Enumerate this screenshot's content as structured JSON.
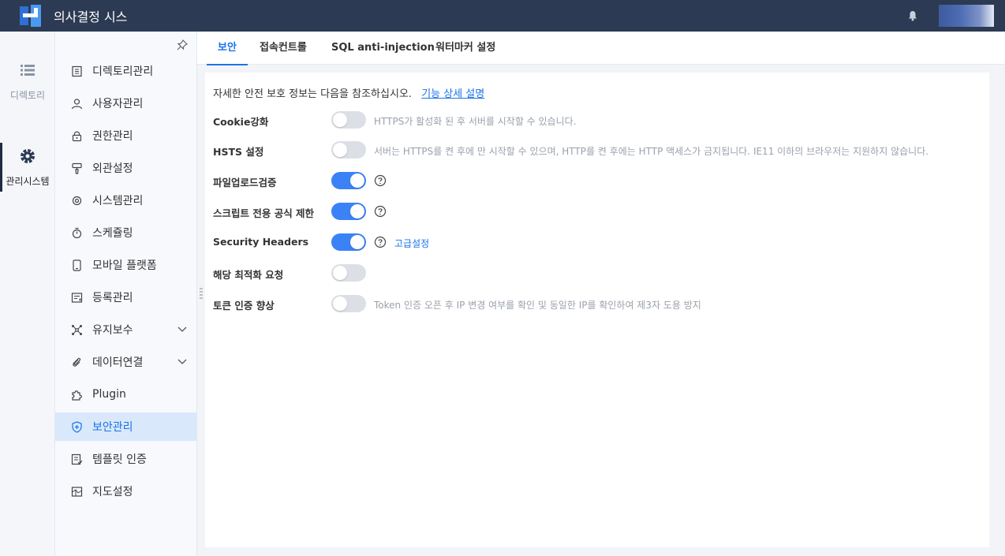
{
  "header": {
    "app_title": "의사결정 시스"
  },
  "rail": [
    {
      "label": "디렉토리",
      "icon": "list-icon"
    },
    {
      "label": "관리시스템",
      "icon": "gear-icon"
    }
  ],
  "sidebar": {
    "items": [
      {
        "label": "디렉토리관리",
        "icon": "directory-icon"
      },
      {
        "label": "사용자관리",
        "icon": "user-icon"
      },
      {
        "label": "권한관리",
        "icon": "lock-icon"
      },
      {
        "label": "외관설정",
        "icon": "brush-icon"
      },
      {
        "label": "시스템관리",
        "icon": "gear-icon"
      },
      {
        "label": "스케쥴링",
        "icon": "timer-icon"
      },
      {
        "label": "모바일 플랫폼",
        "icon": "mobile-icon"
      },
      {
        "label": "등록관리",
        "icon": "register-icon"
      },
      {
        "label": "유지보수",
        "icon": "network-icon"
      },
      {
        "label": "데이터연결",
        "icon": "link-icon"
      },
      {
        "label": "Plugin",
        "icon": "puzzle-icon"
      },
      {
        "label": "보안관리",
        "icon": "shield-icon"
      },
      {
        "label": "템플릿 인증",
        "icon": "template-icon"
      },
      {
        "label": "지도설정",
        "icon": "map-icon"
      }
    ]
  },
  "tabs": [
    {
      "label": "보안"
    },
    {
      "label": "접속컨트롤"
    },
    {
      "label": "SQL anti-injection"
    },
    {
      "label": "워터마커 설정"
    }
  ],
  "main": {
    "info_text": "자세한 안전 보호 정보는 다음을 참조하십시오.",
    "info_link": "기능 상세 설명",
    "advanced_link": "고급설정",
    "settings": [
      {
        "label": "Cookie강화",
        "enabled": false,
        "description": "HTTPS가 활성화 된 후 서버를 시작할 수 있습니다."
      },
      {
        "label": "HSTS 설정",
        "enabled": false,
        "description": "서버는 HTTPS를 켠 후에 만 시작할 수 있으며, HTTP를 켠 후에는 HTTP 액세스가 금지됩니다. IE11 이하의 브라우저는 지원하지 않습니다."
      },
      {
        "label": "파일업로드검증",
        "enabled": true,
        "description": ""
      },
      {
        "label": "스크립트 전용 공식 제한",
        "enabled": true,
        "description": ""
      },
      {
        "label": "Security Headers",
        "enabled": true,
        "description": ""
      },
      {
        "label": "해당 최적화 요청",
        "enabled": false,
        "description": ""
      },
      {
        "label": "토큰 인증 향상",
        "enabled": false,
        "description": "Token 인증 오픈 후 IP 변경 여부를 확인 및 동일한 IP를 확인하여 제3자 도용 방지"
      }
    ]
  },
  "colors": {
    "topbar": "#2c3a53",
    "accent": "#1a73e8",
    "toggle_on": "#3b82f6",
    "toggle_off": "#dcdfe5"
  }
}
